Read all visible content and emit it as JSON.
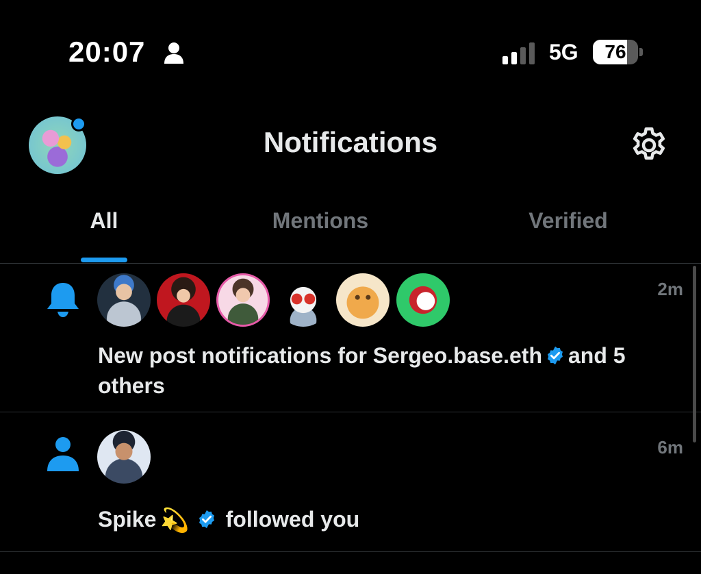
{
  "status_bar": {
    "time": "20:07",
    "network": "5G",
    "battery_level": "76",
    "battery_fraction": 0.76,
    "signal_bars_active": 2
  },
  "header": {
    "title": "Notifications",
    "settings_icon": "gear-icon",
    "profile_icon": "avatar"
  },
  "tabs": [
    {
      "label": "All",
      "active": true
    },
    {
      "label": "Mentions",
      "active": false
    },
    {
      "label": "Verified",
      "active": false
    }
  ],
  "notifications": [
    {
      "type_icon": "bell-icon",
      "time": "2m",
      "text_before": "New post notifications for Sergeo.base.eth",
      "text_after": "and 5 others",
      "avatar_count": 6
    },
    {
      "type_icon": "person-icon",
      "time": "6m",
      "name": "Spike",
      "emoji": "💫",
      "text_after": "followed you"
    }
  ],
  "colors": {
    "accent": "#1d9bf0",
    "background": "#000000",
    "text_primary": "#e7e9ea",
    "text_secondary": "#71767b",
    "divider": "#2f3336"
  }
}
